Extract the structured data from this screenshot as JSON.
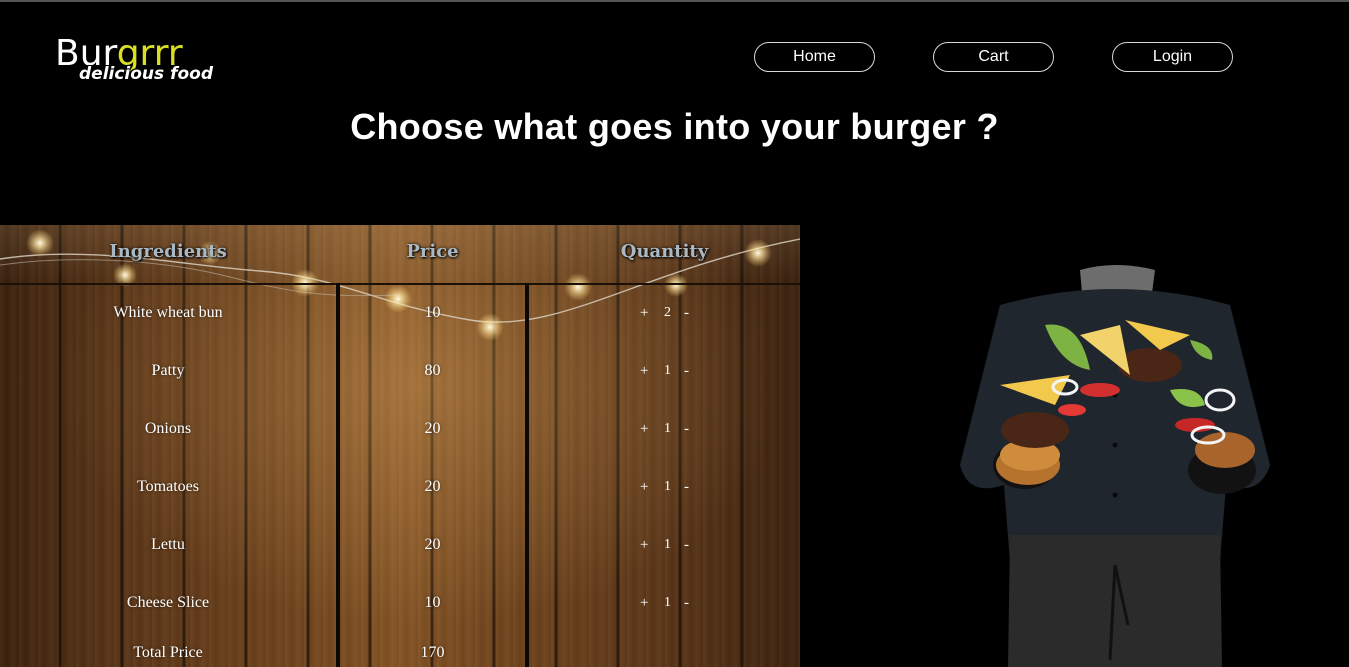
{
  "logo": {
    "part1": "Bur",
    "part2": "grrr",
    "tagline": "delicious food"
  },
  "nav": {
    "home": "Home",
    "cart": "Cart",
    "login": "Login"
  },
  "heading": "Choose what goes into your burger ?",
  "table": {
    "headers": {
      "ingredients": "Ingredients",
      "price": "Price",
      "quantity": "Quantity"
    },
    "rows": [
      {
        "name": "White wheat bun",
        "price": "10",
        "qty": "2"
      },
      {
        "name": "Patty",
        "price": "80",
        "qty": "1"
      },
      {
        "name": "Onions",
        "price": "20",
        "qty": "1"
      },
      {
        "name": "Tomatoes",
        "price": "20",
        "qty": "1"
      },
      {
        "name": "Lettu",
        "price": "20",
        "qty": "1"
      },
      {
        "name": "Cheese Slice",
        "price": "10",
        "qty": "1"
      }
    ],
    "plus": "+",
    "minus": "-",
    "total_label": "Total Price",
    "total_value": "170"
  },
  "colors": {
    "accent": "#d9e021",
    "background": "#000000",
    "header_text": "#a9b8c2"
  },
  "icons": {
    "increment": "plus-icon",
    "decrement": "minus-icon",
    "hero": "chef-burger-image"
  }
}
